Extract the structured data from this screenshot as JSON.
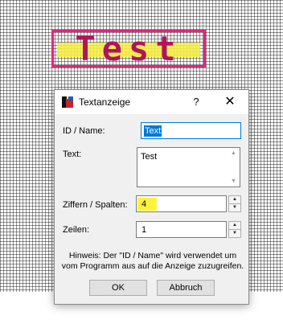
{
  "canvas": {
    "widget_text": "Test",
    "colors": {
      "border": "#e8237a",
      "fill": "#f5ed45",
      "text": "#b0155b"
    }
  },
  "dialog": {
    "title": "Textanzeige",
    "help_label": "?",
    "close_label": "✕",
    "id_label": "ID / Name:",
    "id_value": "Text",
    "text_label": "Text:",
    "text_value": "Test",
    "ziffern_label": "Ziffern / Spalten:",
    "ziffern_value": "4",
    "zeilen_label": "Zeilen:",
    "zeilen_value": "1",
    "hint": "Hinweis: Der \"ID / Name\" wird verwendet um vom Programm aus auf die Anzeige zuzugreifen.",
    "ok_label": "OK",
    "cancel_label": "Abbruch"
  }
}
